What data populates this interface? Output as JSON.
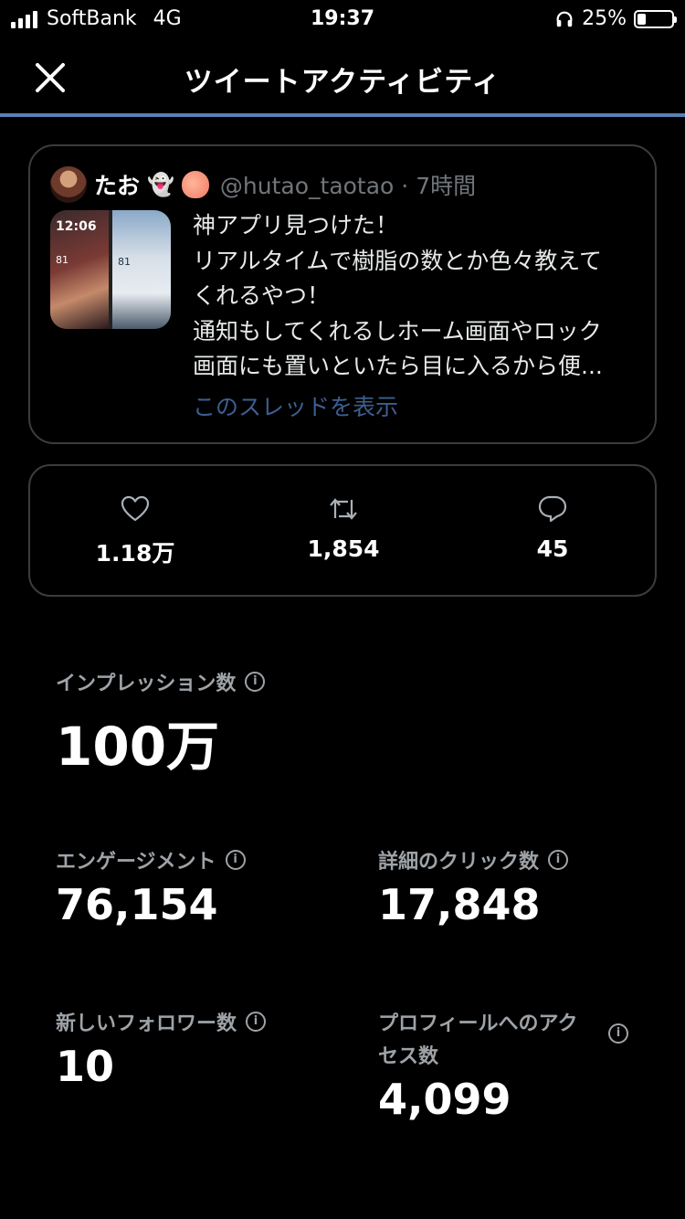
{
  "status_bar": {
    "carrier": "SoftBank",
    "network": "4G",
    "time": "19:37",
    "battery_percent_label": "25%",
    "battery_level": 0.25
  },
  "nav": {
    "title": "ツイートアクティビティ",
    "close_icon": "close-icon"
  },
  "tweet": {
    "display_name": "たお",
    "handle_time": "@hutao_taotao · 7時間",
    "lines": [
      "神アプリ見つけた！",
      "リアルタイムで樹脂の数とか色々教えて",
      "くれるやつ！",
      "通知もしてくれるしホーム画面やロック",
      "画面にも置いといたら目に入るから便..."
    ],
    "thumb_time": "12:06",
    "thumb_value_a": "81",
    "thumb_value_b": "81",
    "show_thread": "このスレッドを表示"
  },
  "engagement_counts": {
    "likes": "1.18万",
    "retweets": "1,854",
    "replies": "45"
  },
  "metrics": {
    "impressions": {
      "label": "インプレッション数",
      "value": "100万"
    },
    "engagements": {
      "label": "エンゲージメント",
      "value": "76,154"
    },
    "detail_clicks": {
      "label": "詳細のクリック数",
      "value": "17,848"
    },
    "new_followers": {
      "label": "新しいフォロワー数",
      "value": "10"
    },
    "profile_visits": {
      "label_line1": "プロフィールへのアク",
      "label_line2": "セス数",
      "value": "4,099"
    }
  },
  "colors": {
    "background": "#000000",
    "accent_rule": "#5b7fb5",
    "link": "#3d5f91",
    "muted": "#9ea3a8"
  }
}
